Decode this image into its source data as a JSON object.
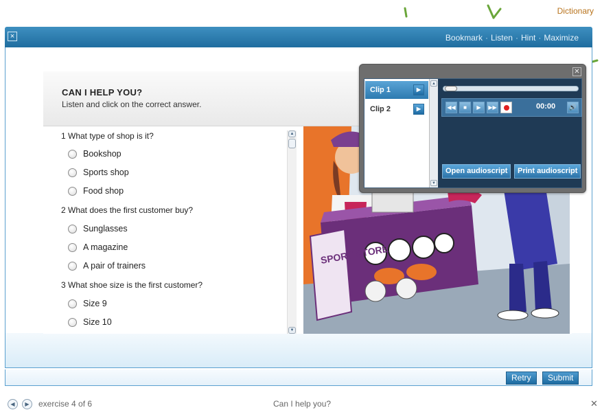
{
  "top": {
    "dictionary_label": "Dictionary"
  },
  "header": {
    "close_glyph": "×",
    "links": [
      "Bookmark",
      "Listen",
      "Hint",
      "Maximize"
    ],
    "separator": "·"
  },
  "exercise": {
    "title": "CAN I HELP YOU?",
    "instruction": "Listen and click on the correct answer.",
    "questions": [
      {
        "text": "1 What type of shop is it?",
        "options": [
          "Bookshop",
          "Sports shop",
          "Food shop"
        ]
      },
      {
        "text": "2 What does the first customer buy?",
        "options": [
          "Sunglasses",
          "A magazine",
          "A pair of trainers"
        ]
      },
      {
        "text": "3 What shoe size is the first customer?",
        "options": [
          "Size 9",
          "Size 10"
        ]
      }
    ],
    "illustration_sign": "SPORT STORE"
  },
  "player": {
    "clips": [
      "Clip 1",
      "Clip 2"
    ],
    "active_clip": "Clip 1",
    "time": "00:00",
    "open_audioscript": "Open audioscript",
    "print_audioscript": "Print audioscript"
  },
  "footer": {
    "retry": "Retry",
    "submit": "Submit"
  },
  "status": {
    "counter": "exercise 4 of 6",
    "title": "Can I help you?"
  },
  "colors": {
    "header_blue": "#2a7db3",
    "dictionary_orange": "#b8731c",
    "guide_green": "#6aa63a",
    "record_red": "#e02020"
  }
}
